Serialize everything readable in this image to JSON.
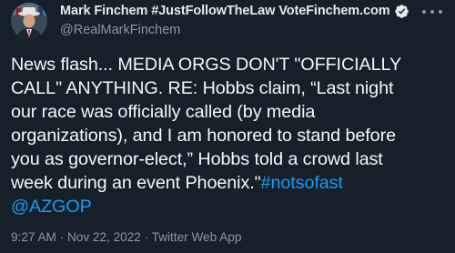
{
  "tweet": {
    "author": {
      "display_name": "Mark Finchem #JustFollowTheLaw VoteFinchem.com",
      "handle": "@RealMarkFinchem",
      "verified_icon": "verified-badge-icon"
    },
    "text_lines": [
      "News flash... MEDIA ORGS DON'T \"OFFICIALLY",
      "CALL\" ANYTHING. RE: Hobbs claim, “Last night",
      "our race was officially called (by media",
      "organizations), and I am honored to stand before",
      "you as governor-elect,” Hobbs told a crowd last",
      "week during an event Phoenix.\""
    ],
    "hashtag": "#notsofast",
    "mention": "@AZGOP",
    "meta": "9:27 AM · Nov 22, 2022 · Twitter Web App",
    "colors": {
      "background": "#15202b",
      "link": "#1d9bf0",
      "secondary_text": "#8b98a5"
    }
  }
}
